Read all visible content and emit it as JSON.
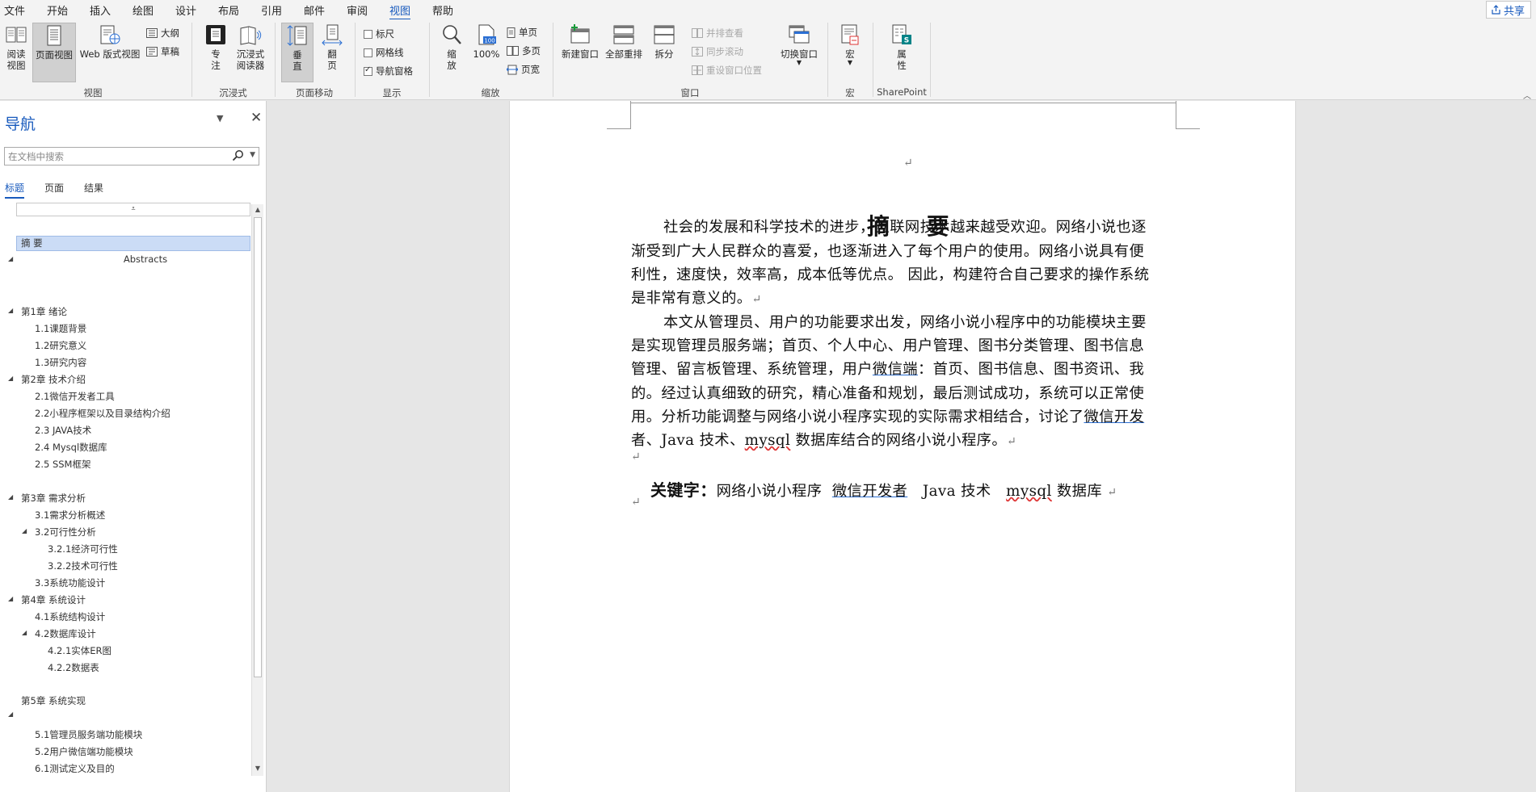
{
  "menu": {
    "tabs": [
      "文件",
      "开始",
      "插入",
      "绘图",
      "设计",
      "布局",
      "引用",
      "邮件",
      "审阅",
      "视图",
      "帮助"
    ],
    "active": "视图",
    "share": "共享"
  },
  "ribbon": {
    "view_group": {
      "read_mode_1": "阅读",
      "read_mode_2": "视图",
      "page_view": "页面视图",
      "web_view": "Web 版式视图",
      "outline": "大纲",
      "draft": "草稿",
      "label": "视图"
    },
    "immersive_group": {
      "focus_1": "专",
      "focus_2": "注",
      "reader_1": "沉浸式",
      "reader_2": "阅读器",
      "label": "沉浸式"
    },
    "page_move_group": {
      "vertical_1": "垂",
      "vertical_2": "直",
      "side_1": "翻",
      "side_2": "页",
      "label": "页面移动"
    },
    "show_group": {
      "ruler": "标尺",
      "gridlines": "网格线",
      "nav_pane": "导航窗格",
      "label": "显示"
    },
    "zoom_group": {
      "zoom_1": "缩",
      "zoom_2": "放",
      "hundred": "100%",
      "one_page": "单页",
      "multi_page": "多页",
      "page_width": "页宽",
      "label": "缩放"
    },
    "window_group": {
      "new_window": "新建窗口",
      "arrange_all": "全部重排",
      "split": "拆分",
      "side_by_side": "并排查看",
      "sync_scroll": "同步滚动",
      "reset_pos": "重设窗口位置",
      "switch_window": "切换窗口",
      "label": "窗口"
    },
    "macro_group": {
      "macro": "宏",
      "label": "宏"
    },
    "sharepoint_group": {
      "props_1": "属",
      "props_2": "性",
      "label": "SharePoint"
    }
  },
  "nav": {
    "title": "导航",
    "search_placeholder": "在文档中搜索",
    "tabs": [
      "标题",
      "页面",
      "结果"
    ],
    "active_tab": "标题",
    "headings": [
      {
        "text": "摘  要",
        "level": 1,
        "selected": true
      },
      {
        "text": "Abstracts",
        "level": 0
      },
      {
        "text": "第1章 绪论",
        "level": 1
      },
      {
        "text": "1.1课题背景",
        "level": 2
      },
      {
        "text": "1.2研究意义",
        "level": 2
      },
      {
        "text": "1.3研究内容",
        "level": 2
      },
      {
        "text": "第2章 技术介绍",
        "level": 1
      },
      {
        "text": "2.1微信开发者工具",
        "level": 2
      },
      {
        "text": "2.2小程序框架以及目录结构介绍",
        "level": 2
      },
      {
        "text": "2.3 JAVA技术",
        "level": 2
      },
      {
        "text": "2.4  Mysql数据库",
        "level": 2
      },
      {
        "text": "2.5 SSM框架",
        "level": 2
      },
      {
        "text": "第3章 需求分析",
        "level": 1
      },
      {
        "text": "3.1需求分析概述",
        "level": 2
      },
      {
        "text": "3.2可行性分析",
        "level": 2
      },
      {
        "text": "3.2.1经济可行性",
        "level": 3
      },
      {
        "text": "3.2.2技术可行性",
        "level": 3
      },
      {
        "text": "3.3系统功能设计",
        "level": 2
      },
      {
        "text": "第4章 系统设计",
        "level": 1
      },
      {
        "text": "4.1系统结构设计",
        "level": 2
      },
      {
        "text": "4.2数据库设计",
        "level": 2
      },
      {
        "text": "4.2.1实体ER图",
        "level": 3
      },
      {
        "text": "4.2.2数据表",
        "level": 3
      },
      {
        "text": "第5章 系统实现",
        "level": 1
      },
      {
        "text": "5.1管理员服务端功能模块",
        "level": 2
      },
      {
        "text": "5.2用户微信端功能模块",
        "level": 2
      },
      {
        "text": "6.1测试定义及目的",
        "level": 2
      }
    ]
  },
  "document": {
    "title": "摘  要",
    "para1": [
      "社会的发展和科学技术的进步，互联网技术越来越受欢迎。网络小说也逐",
      "渐受到广大人民群众的喜爱，也逐渐进入了每个用户的使用。网络小说具有便",
      "利性，速度快，效率高，成本低等优点。 因此，构建符合自己要求的操作系统",
      "是非常有意义的。"
    ],
    "para2": [
      "本文从管理员、用户的功能要求出发，网络小说小程序中的功能模块主要",
      "是实现管理员服务端；首页、个人中心、用户管理、图书分类管理、图书信息",
      "管理、留言板管理、系统管理，用户",
      "微信端",
      "：首页、图书信息、图书资讯、我",
      "的。经过认真细致的研究，精心准备和规划，最后测试成功，系统可以正常使",
      "用。分析功能调整与网络小说小程序实现的实际需求相结合，讨论了",
      "微信开发",
      "者、Java 技术、",
      "mysql",
      " 数据库结合的网络小说小程序。"
    ],
    "keywords_label": "关键字：",
    "keywords": [
      "网络小说小程序",
      "微信开发者",
      "Java 技术",
      "mysql",
      "数据库"
    ]
  }
}
